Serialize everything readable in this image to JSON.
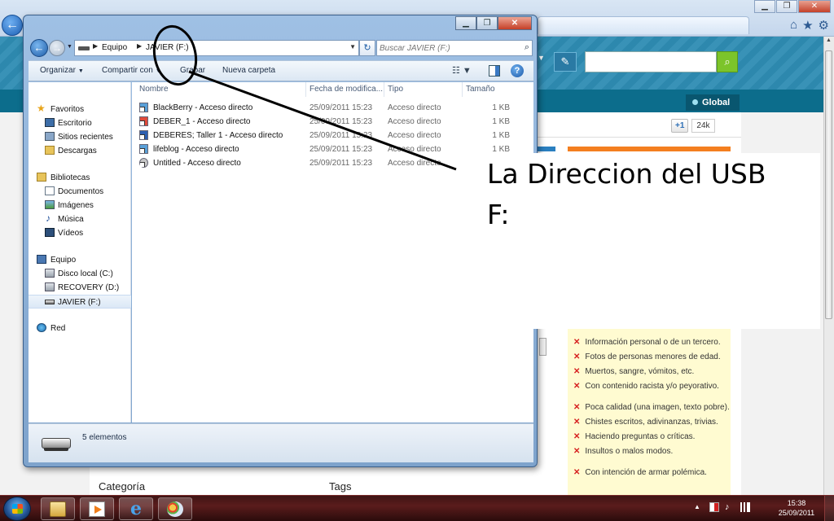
{
  "explorer": {
    "address": {
      "root": "Equipo",
      "current": "JAVIER (F:)"
    },
    "search_placeholder": "Buscar JAVIER (F:)",
    "toolbar": {
      "organize": "Organizar",
      "share": "Compartir con",
      "burn": "Grabar",
      "new_folder": "Nueva carpeta"
    },
    "nav": {
      "favorites": {
        "label": "Favoritos",
        "items": [
          "Escritorio",
          "Sitios recientes",
          "Descargas"
        ]
      },
      "libraries": {
        "label": "Bibliotecas",
        "items": [
          "Documentos",
          "Imágenes",
          "Música",
          "Vídeos"
        ]
      },
      "computer": {
        "label": "Equipo",
        "items": [
          "Disco local (C:)",
          "RECOVERY (D:)",
          "JAVIER (F:)"
        ]
      },
      "network": {
        "label": "Red"
      }
    },
    "columns": {
      "name": "Nombre",
      "date": "Fecha de modifica...",
      "type": "Tipo",
      "size": "Tamaño"
    },
    "files": [
      {
        "name": "BlackBerry - Acceso directo",
        "date": "25/09/2011 15:23",
        "type": "Acceso directo",
        "size": "1 KB"
      },
      {
        "name": "DEBER_1 - Acceso directo",
        "date": "25/09/2011 15:23",
        "type": "Acceso directo",
        "size": "1 KB"
      },
      {
        "name": "DEBERES; Taller 1 - Acceso directo",
        "date": "25/09/2011 15:23",
        "type": "Acceso directo",
        "size": "1 KB"
      },
      {
        "name": "lifeblog - Acceso directo",
        "date": "25/09/2011 15:23",
        "type": "Acceso directo",
        "size": "1 KB"
      },
      {
        "name": "Untitled - Acceso directo",
        "date": "25/09/2011 15:23",
        "type": "Acceso directo",
        "size": ""
      }
    ],
    "status": "5 elementos"
  },
  "annotation": {
    "line1": "La Direccion del USB",
    "line2": "F:"
  },
  "website": {
    "global_label": "Global",
    "gplus_label": "+1",
    "gplus_count": "24k",
    "rules": [
      "Información personal o de un tercero.",
      "Fotos de personas menores de edad.",
      "Muertos, sangre, vómitos, etc.",
      "Con contenido racista y/o peyorativo.",
      "Poca calidad (una imagen, texto pobre).",
      "Chistes escritos, adivinanzas, trivias.",
      "Haciendo preguntas o críticas.",
      "Insultos o malos modos.",
      "Con intención de armar polémica."
    ],
    "categoria": "Categoría",
    "tags": "Tags"
  },
  "taskbar": {
    "time": "15:38",
    "date": "25/09/2011"
  },
  "colors": {
    "site_header": "#2e8cb3",
    "site_nav": "#0c6d8c",
    "rules_panel": "#fffbd1",
    "orange_accent": "#f47f1f",
    "taskbar": "#5a1c1c",
    "annotation_ink": "#000000"
  }
}
